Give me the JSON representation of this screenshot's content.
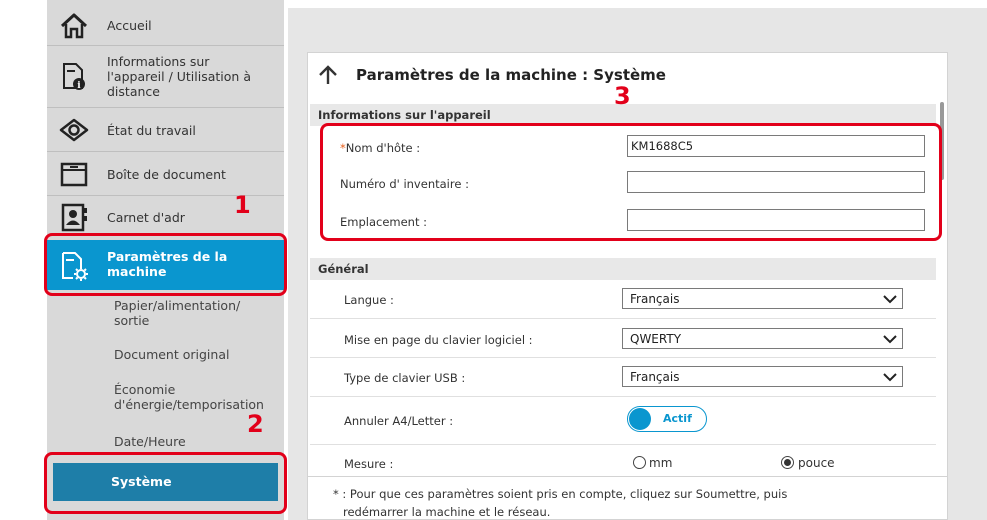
{
  "sidebar": {
    "items": [
      {
        "label": "Accueil",
        "icon": "home-icon"
      },
      {
        "label": "Informations sur l'appareil / Utilisation à distance",
        "label_lines": [
          "Informations sur",
          "l'appareil / Utilisation à",
          "distance"
        ],
        "icon": "device-info-icon"
      },
      {
        "label": "État du travail",
        "icon": "eye-icon"
      },
      {
        "label": "Boîte de document",
        "icon": "document-box-icon"
      },
      {
        "label": "Carnet d'adr",
        "icon": "address-book-icon"
      },
      {
        "label": "Paramètres de la machine",
        "label_lines": [
          "Paramètres de la",
          "machine"
        ],
        "icon": "machine-settings-icon",
        "active": true
      }
    ],
    "subitems": [
      {
        "label": "Papier/alimentation/ sortie",
        "label_lines": [
          "Papier/alimentation/",
          "sortie"
        ]
      },
      {
        "label": "Document original"
      },
      {
        "label": "Économie d'énergie/temporisation",
        "label_lines": [
          "Économie",
          "d'énergie/temporisation"
        ]
      },
      {
        "label": "Date/Heure"
      },
      {
        "label": "Système",
        "selected": true
      }
    ]
  },
  "page": {
    "title": "Paramètres de la machine : Système",
    "back_icon": "arrow-up-icon"
  },
  "device_info": {
    "heading": "Informations sur l'appareil",
    "required_mark": "*",
    "hostname_label": "Nom d'hôte :",
    "hostname_value": "KM1688C5",
    "asset_label": "Numéro d' inventaire :",
    "asset_value": "",
    "location_label": "Emplacement :",
    "location_value": ""
  },
  "general": {
    "heading": "Général",
    "language_label": "Langue :",
    "language_value": "Français",
    "soft_keyboard_label": "Mise en page du clavier logiciel :",
    "soft_keyboard_value": "QWERTY",
    "usb_keyboard_label": "Type de clavier USB :",
    "usb_keyboard_value": "Français",
    "a4letter_label": "Annuler A4/Letter  :",
    "a4letter_toggle": "Actif",
    "a4letter_on": true,
    "measure_label": "Mesure  :",
    "measure_option_mm": "mm",
    "measure_option_inch": "pouce",
    "measure_selected": "pouce"
  },
  "footnote": {
    "line1": "* : Pour que ces paramètres soient pris en compte, cliquez sur Soumettre, puis",
    "line2": "redémarrer la machine et le réseau."
  },
  "callouts": [
    "1",
    "2",
    "3"
  ],
  "colors": {
    "accent": "#0a96cf",
    "selected_sub": "#1e7ea8",
    "sidebar_bg": "#d9d9d9",
    "callout": "#e2001a",
    "required": "#e8601c"
  }
}
